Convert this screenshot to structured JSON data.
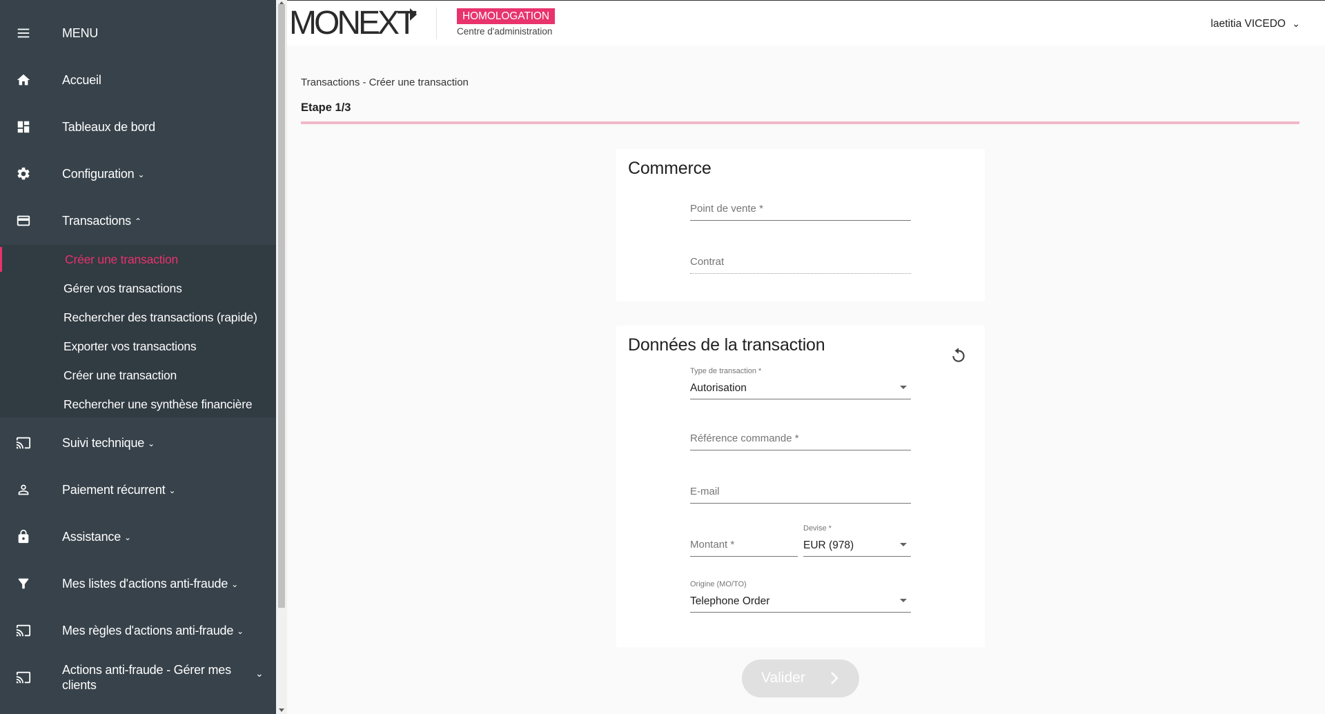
{
  "sidebar": {
    "menu_label": "MENU",
    "items": [
      {
        "label": "Accueil",
        "icon": "home-icon"
      },
      {
        "label": "Tableaux de bord",
        "icon": "dashboard-icon"
      },
      {
        "label": "Configuration",
        "icon": "gear-icon",
        "expandable": true
      },
      {
        "label": "Transactions",
        "icon": "credit-card-icon",
        "expanded": true
      },
      {
        "label": "Suivi technique",
        "icon": "cast-icon",
        "expandable": true
      },
      {
        "label": "Paiement récurrent",
        "icon": "person-icon",
        "expandable": true
      },
      {
        "label": "Assistance",
        "icon": "lock-icon",
        "expandable": true
      },
      {
        "label": "Mes listes d'actions anti-fraude",
        "icon": "filter-icon",
        "expandable": true
      },
      {
        "label": "Mes règles d'actions anti-fraude",
        "icon": "cast-icon",
        "expandable": true
      },
      {
        "label": "Actions anti-fraude - Gérer mes clients",
        "icon": "cast-icon",
        "expandable": true
      }
    ],
    "transactions_sub": [
      "Créer une transaction",
      "Gérer vos transactions",
      "Rechercher des transactions (rapide)",
      "Exporter vos transactions",
      "Créer une transaction",
      "Rechercher une synthèse financière"
    ]
  },
  "header": {
    "logo_text": "MONEXT",
    "environment_badge": "HOMOLOGATION",
    "admin_label": "Centre d'administration",
    "user_name": "laetitia VICEDO"
  },
  "page": {
    "breadcrumb": "Transactions - Créer une transaction",
    "step": "Etape 1/3"
  },
  "commerce": {
    "title": "Commerce",
    "point_de_vente_placeholder": "Point de vente *",
    "contrat_placeholder": "Contrat"
  },
  "transaction": {
    "title": "Données de la transaction",
    "type_label": "Type de transaction *",
    "type_value": "Autorisation",
    "reference_placeholder": "Référence commande *",
    "email_placeholder": "E-mail",
    "montant_placeholder": "Montant *",
    "devise_label": "Devise *",
    "devise_value": "EUR (978)",
    "origine_label": "Origine (MO/TO)",
    "origine_value": "Telephone Order"
  },
  "actions": {
    "submit_label": "Valider"
  },
  "colors": {
    "sidebar_bg": "#37424a",
    "accent": "#e8336d",
    "step_bar": "#f2b8c9"
  }
}
